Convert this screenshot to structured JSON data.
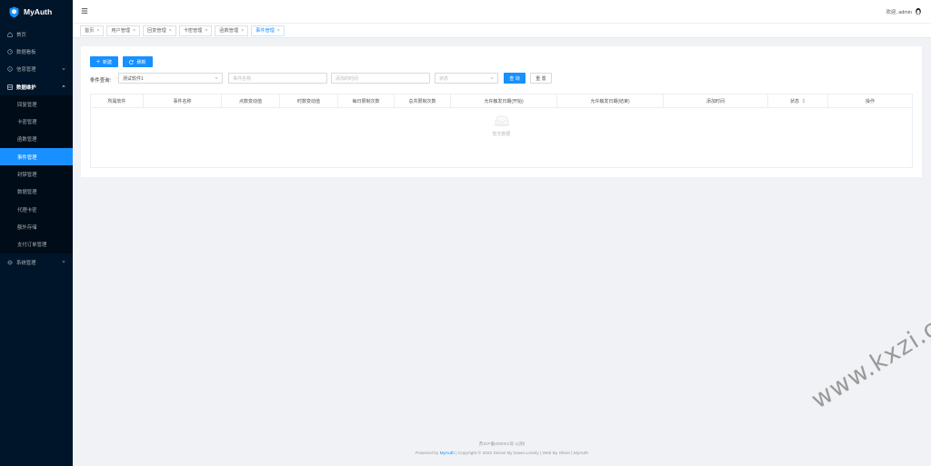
{
  "brand": {
    "name": "MyAuth",
    "color": "#1890ff"
  },
  "sidebar": {
    "items": [
      {
        "label": "首页",
        "icon": "home-icon"
      },
      {
        "label": "数据看板",
        "icon": "dashboard-icon"
      },
      {
        "label": "信息管理",
        "icon": "info-icon",
        "has_arrow": true
      },
      {
        "label": "数据维护",
        "icon": "data-icon",
        "open": true
      }
    ],
    "sub_items": [
      {
        "label": "回复管理"
      },
      {
        "label": "卡密管理"
      },
      {
        "label": "函数管理"
      },
      {
        "label": "事件管理",
        "active": true
      },
      {
        "label": "封禁管理"
      },
      {
        "label": "数据管理"
      },
      {
        "label": "代理卡密"
      },
      {
        "label": "额外存储"
      },
      {
        "label": "支付订单管理"
      }
    ],
    "bottom_item": {
      "label": "系统管理",
      "icon": "gear-icon"
    }
  },
  "header": {
    "greeting": "欢迎, admin"
  },
  "tabs": [
    {
      "label": "首页"
    },
    {
      "label": "用户管理"
    },
    {
      "label": "回复管理"
    },
    {
      "label": "卡密管理"
    },
    {
      "label": "函数管理"
    },
    {
      "label": "事件管理",
      "active": true
    }
  ],
  "toolbar": {
    "new_label": "新建",
    "refresh_label": "刷新"
  },
  "query": {
    "label": "条件查询:",
    "software_value": "测试软件1",
    "event_name_placeholder": "事件名称",
    "add_time_placeholder": "添加的时间",
    "status_placeholder": "状态",
    "search_label": "查 询",
    "reset_label": "重 置"
  },
  "table": {
    "columns": [
      "所属软件",
      "事件名称",
      "点数变动值",
      "时数变动值",
      "每日限制次数",
      "总共限制次数",
      "允许触发日期(开始)",
      "允许触发日期(结束)",
      "添加时间",
      "状态",
      "操作"
    ],
    "empty_text": "暂无数据"
  },
  "footer": {
    "icp": "苏ICP备000001号-1(测)",
    "powered_prefix": "Powered by ",
    "powered_link": "MyAuth",
    "powered_suffix": " | Copyright © 2022 Server By Dawn.Lonely | Web By Shine | MyAuth"
  },
  "watermark": "www.kxzi.cn"
}
